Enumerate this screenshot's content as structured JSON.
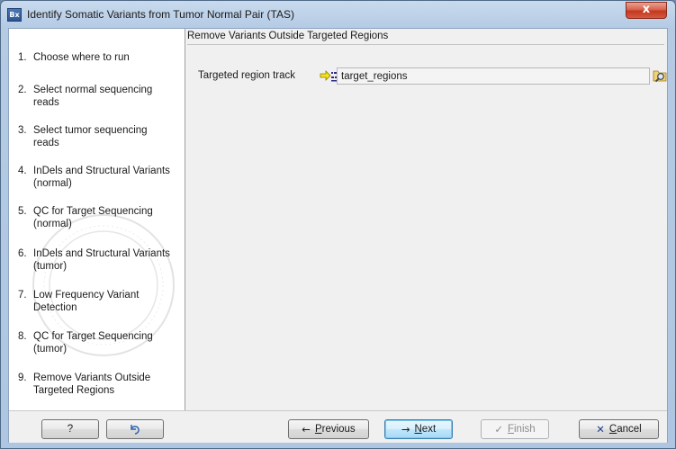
{
  "window": {
    "icon_text": "Bx",
    "title": "Identify Somatic Variants from Tumor Normal Pair (TAS)",
    "close_glyph": "x"
  },
  "sidebar": {
    "steps": [
      {
        "num": "1.",
        "label": "Choose where to run"
      },
      {
        "num": "2.",
        "label": "Select normal sequencing reads"
      },
      {
        "num": "3.",
        "label": "Select tumor sequencing reads"
      },
      {
        "num": "4.",
        "label": "InDels and Structural Variants (normal)"
      },
      {
        "num": "5.",
        "label": "QC for Target Sequencing (normal)"
      },
      {
        "num": "6.",
        "label": "InDels and Structural Variants (tumor)"
      },
      {
        "num": "7.",
        "label": "Low Frequency Variant Detection"
      },
      {
        "num": "8.",
        "label": "QC for Target Sequencing (tumor)"
      },
      {
        "num": "9.",
        "label": "Remove Variants Outside Targeted Regions"
      }
    ]
  },
  "main": {
    "section_title": "Remove Variants Outside Targeted Regions",
    "field_label": "Targeted region track",
    "field_value": "target_regions"
  },
  "footer": {
    "help_label": "?",
    "reset_icon": "reset-icon",
    "previous_label_u": "P",
    "previous_label_rest": "revious",
    "next_label_u": "N",
    "next_label_rest": "ext",
    "finish_label_u": "F",
    "finish_label_rest": "inish",
    "cancel_label_u": "C",
    "cancel_label_rest": "ancel"
  },
  "colors": {
    "title_bar": "#b5cbe4",
    "close_button": "#c2371f",
    "default_button_border": "#3c7fb1"
  }
}
